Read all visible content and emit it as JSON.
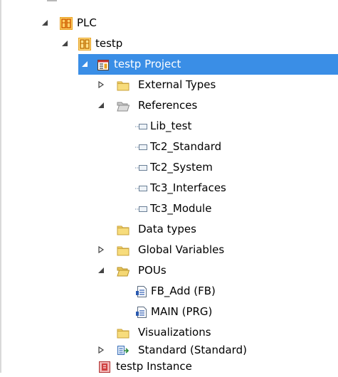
{
  "tree": {
    "nodes": [
      {
        "label": "PLC",
        "icon": "plc-module-icon",
        "expanded": true,
        "level": 0
      },
      {
        "label": "testp",
        "icon": "plc-project-icon",
        "expanded": true,
        "level": 1
      },
      {
        "label": "testp Project",
        "icon": "plc-project-file-icon",
        "expanded": true,
        "selected": true,
        "level": 2
      },
      {
        "label": "External Types",
        "icon": "folder-icon",
        "expanded": false,
        "level": 3
      },
      {
        "label": "References",
        "icon": "folder-open-icon",
        "expanded": true,
        "level": 3
      },
      {
        "label": "Lib_test",
        "icon": "library-reference-icon",
        "level": 4
      },
      {
        "label": "Tc2_Standard",
        "icon": "library-reference-icon",
        "level": 4
      },
      {
        "label": "Tc2_System",
        "icon": "library-reference-icon",
        "level": 4
      },
      {
        "label": "Tc3_Interfaces",
        "icon": "library-reference-icon",
        "level": 4
      },
      {
        "label": "Tc3_Module",
        "icon": "library-reference-icon",
        "level": 4
      },
      {
        "label": "Data types",
        "icon": "folder-icon",
        "level": 3
      },
      {
        "label": "Global Variables",
        "icon": "folder-icon",
        "expanded": false,
        "level": 3
      },
      {
        "label": "POUs",
        "icon": "folder-open-icon",
        "expanded": true,
        "level": 3
      },
      {
        "label": "FB_Add (FB)",
        "icon": "pou-icon",
        "level": 4
      },
      {
        "label": "MAIN (PRG)",
        "icon": "pou-icon",
        "level": 4
      },
      {
        "label": "Visualizations",
        "icon": "folder-icon",
        "level": 3
      },
      {
        "label": "Standard (Standard)",
        "icon": "task-reference-icon",
        "expanded": false,
        "level": 3
      },
      {
        "label": "testp Instance",
        "icon": "plc-instance-icon",
        "level": 2
      }
    ]
  },
  "colors": {
    "selection": "#3a8ee6",
    "folder": "#e8c35a",
    "plc_icon": "#e8a020",
    "instance_icon": "#d04040"
  }
}
